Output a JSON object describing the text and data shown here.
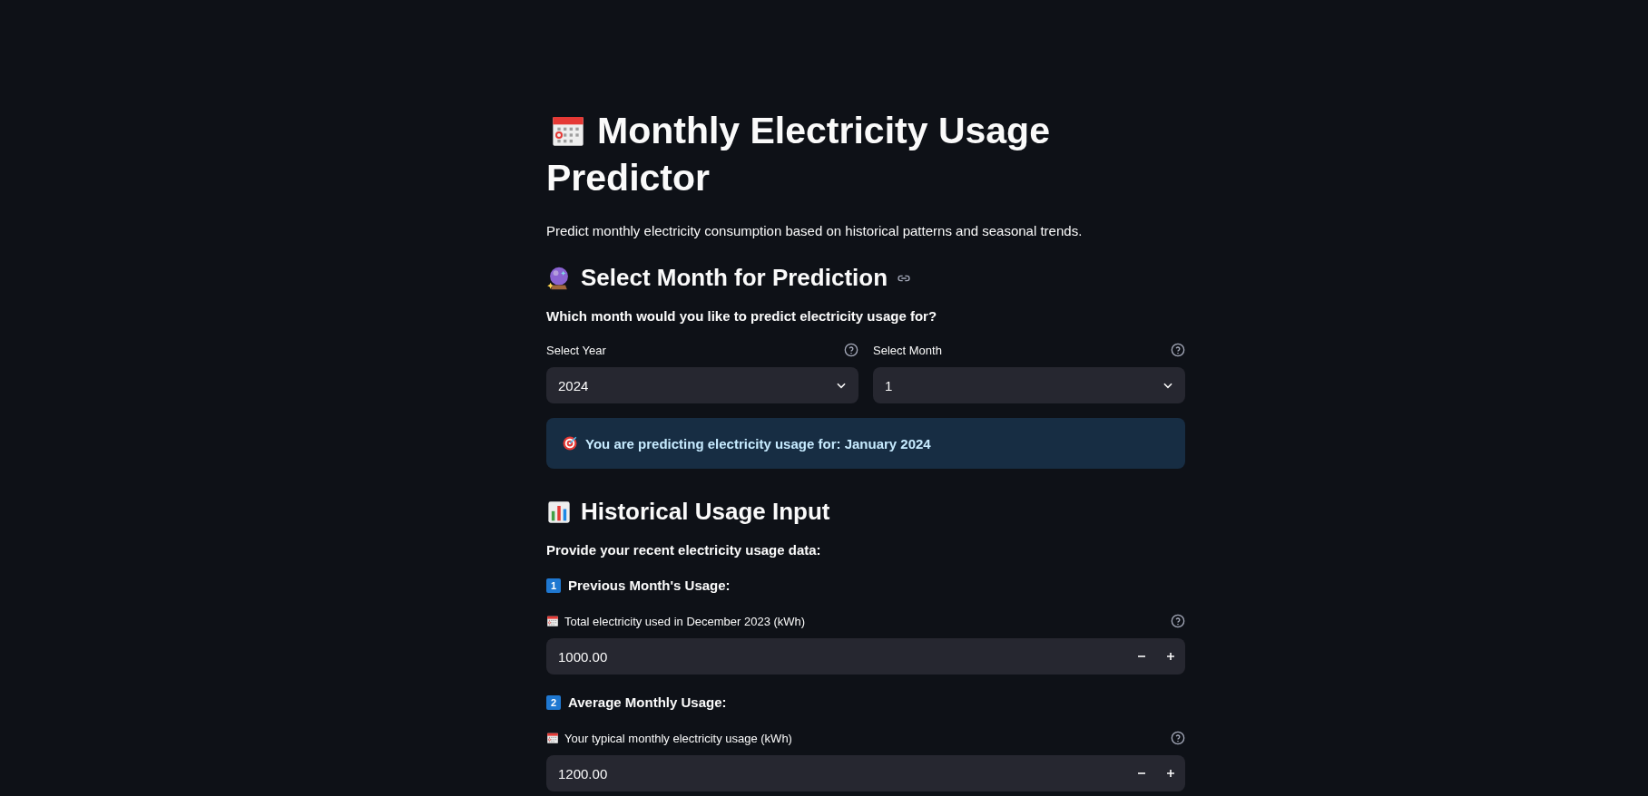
{
  "title": "Monthly Electricity Usage Predictor",
  "description": "Predict monthly electricity consumption based on historical patterns and seasonal trends.",
  "select_section": {
    "heading": "Select Month for Prediction",
    "question": "Which month would you like to predict electricity usage for?",
    "selects": [
      {
        "label": "Select Year",
        "value": "2024"
      },
      {
        "label": "Select Month",
        "value": "1"
      }
    ],
    "info": "You are predicting electricity usage for: January 2024"
  },
  "history_section": {
    "heading": "Historical Usage Input",
    "intro": "Provide your recent electricity usage data:",
    "inputs": [
      {
        "number": "1",
        "heading": "Previous Month's Usage:",
        "label": "Total electricity used in December 2023 (kWh)",
        "value": "1000.00"
      },
      {
        "number": "2",
        "heading": "Average Monthly Usage:",
        "label": "Your typical monthly electricity usage (kWh)",
        "value": "1200.00"
      }
    ]
  }
}
